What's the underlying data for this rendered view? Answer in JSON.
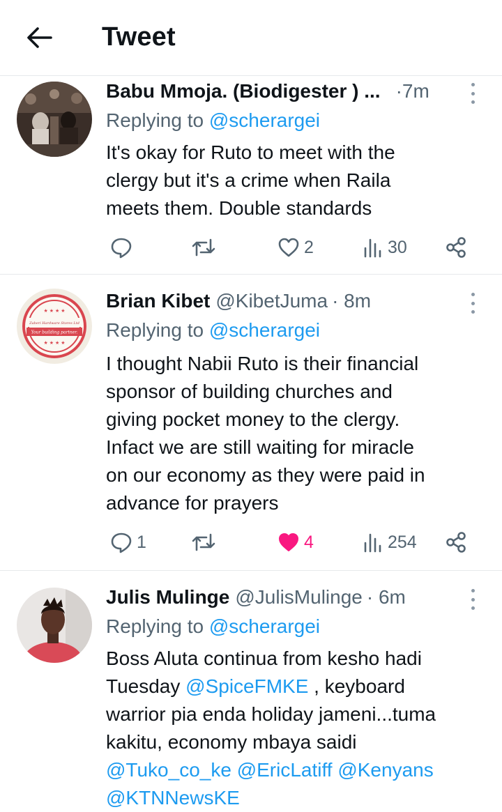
{
  "header": {
    "title": "Tweet"
  },
  "tweets": [
    {
      "name": "Babu Mmoja. (Biodigester ) ...",
      "handle": "",
      "time": "·7m",
      "replying_prefix": "Replying to",
      "replying_to": "@scherargei",
      "text_lines": [
        "It's okay for Ruto to meet with the",
        "clergy but it's a crime when Raila",
        "meets them. Double standards"
      ],
      "replies": "",
      "retweets": "",
      "likes": "2",
      "views": "30",
      "liked": false
    },
    {
      "name": "Brian Kibet",
      "handle": "@KibetJuma",
      "time": "· 8m",
      "replying_prefix": "Replying to",
      "replying_to": "@scherargei",
      "text_lines": [
        "I thought Nabii Ruto is their financial",
        "sponsor of building churches and",
        "giving pocket money to the clergy.",
        "Infact we are still waiting for miracle",
        "on our economy as they were paid in",
        "advance for prayers"
      ],
      "replies": "1",
      "retweets": "",
      "likes": "4",
      "views": "254",
      "liked": true,
      "avatar_text": {
        "top": "Zaberi Hardware Stores Ltd",
        "bottom": "Your building partner."
      }
    },
    {
      "name": "Julis Mulinge",
      "handle": "@JulisMulinge",
      "time": "· 6m",
      "replying_prefix": "Replying to",
      "replying_to": "@scherargei",
      "text_line1": "Boss Aluta continua from kesho hadi",
      "text_line2_a": "Tuesday ",
      "text_line2_mention": "@SpiceFMKE",
      "text_line2_b": " , keyboard",
      "text_line3": "warrior pia enda holiday jameni...tuma",
      "text_line4": "kakitu, economy mbaya saidi",
      "mentions_line5": "@Tuko_co_ke @EricLatiff @Kenyans",
      "mentions_line6": "@KTNNewsKE"
    }
  ],
  "colors": {
    "accent": "#1d9bf0",
    "like": "#f91880",
    "secondary": "#536471",
    "divider": "#e6e9eb"
  },
  "icons": [
    "arrow-left-icon",
    "more-vertical-icon",
    "reply-icon",
    "retweet-icon",
    "heart-icon",
    "views-icon",
    "share-icon"
  ]
}
